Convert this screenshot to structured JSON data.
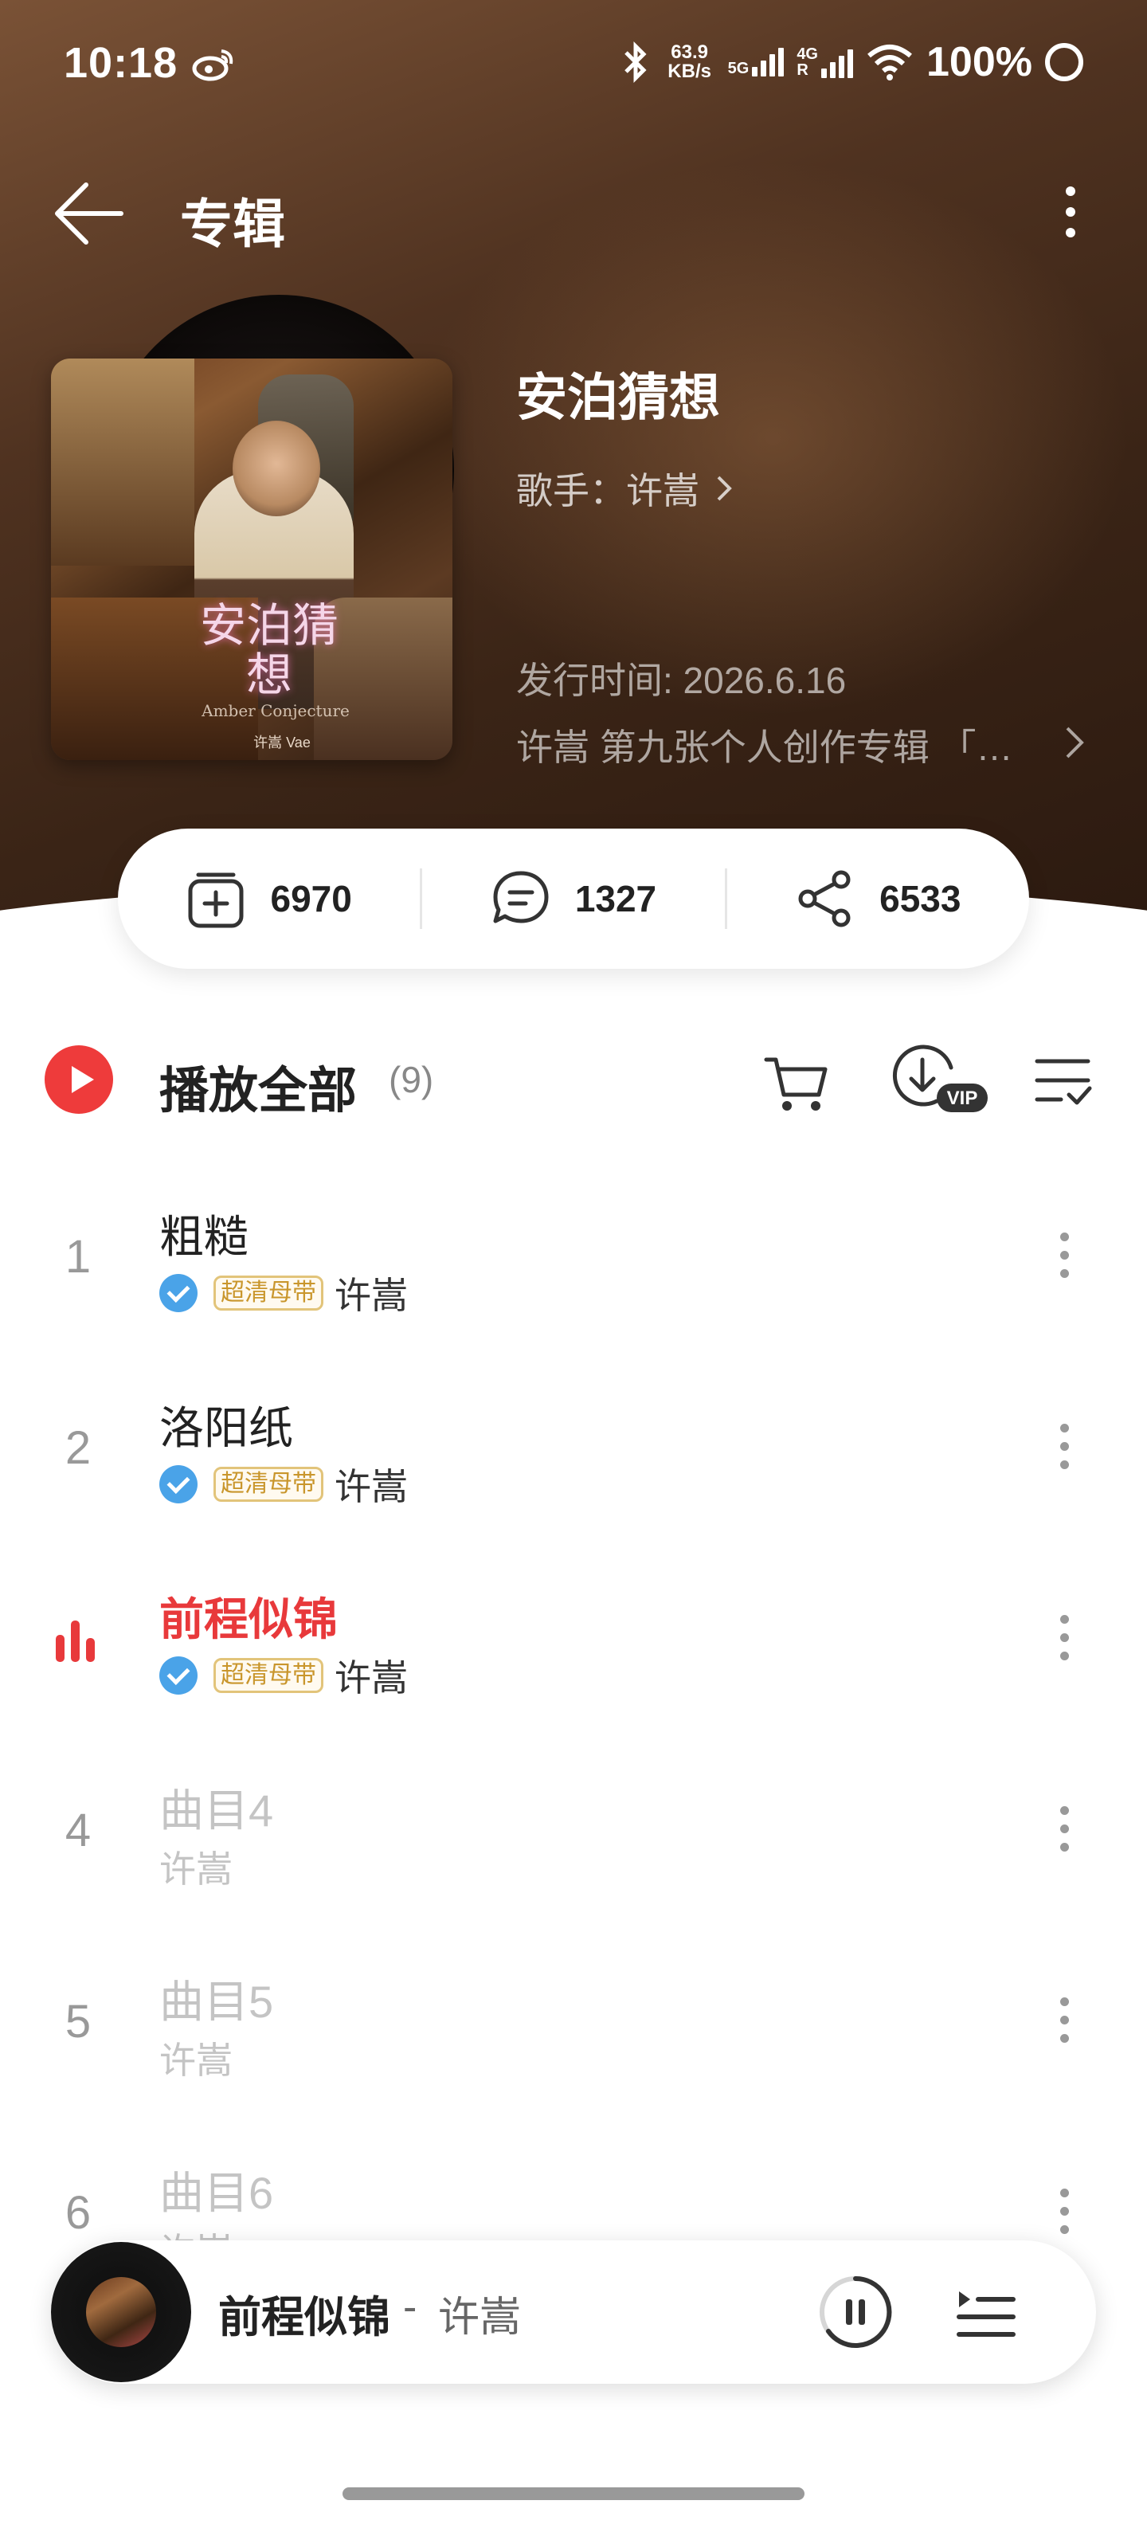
{
  "status_bar": {
    "time": "10:18",
    "net_speed_value": "63.9",
    "net_speed_unit": "KB/s",
    "sim1_label": "5G",
    "sim2_label": "4G",
    "sim2_roaming": "R",
    "battery": "100%"
  },
  "header": {
    "title": "专辑"
  },
  "album": {
    "cover_title": "安泊猜想",
    "cover_subtitle": "Amber Conjecture",
    "cover_artist": "许嵩 Vae",
    "title": "安泊猜想",
    "artist_line": "歌手：许嵩",
    "release": "发行时间: 2026.6.16",
    "description": "许嵩 第九张个人创作专辑 「…"
  },
  "stats": {
    "collect_count": "6970",
    "comment_count": "1327",
    "share_count": "6533"
  },
  "play_all": {
    "label": "播放全部",
    "count": "(9)"
  },
  "tracks": [
    {
      "num": "1",
      "title": "粗糙",
      "badge": "超清母带",
      "artist": "许嵩"
    },
    {
      "num": "2",
      "title": "洛阳纸",
      "badge": "超清母带",
      "artist": "许嵩"
    },
    {
      "num": "3",
      "title": "前程似锦",
      "badge": "超清母带",
      "artist": "许嵩"
    },
    {
      "num": "4",
      "title": "曲目4",
      "artist": "许嵩"
    },
    {
      "num": "5",
      "title": "曲目5",
      "artist": "许嵩"
    },
    {
      "num": "6",
      "title": "曲目6",
      "artist": "许嵩"
    }
  ],
  "now_playing": {
    "title": "前程似锦",
    "separator": "-",
    "artist": "许嵩"
  },
  "colors": {
    "accent": "#e8393b",
    "verified": "#4aa3e8",
    "badge": "#c9962c",
    "header_bg": "#4f3220"
  }
}
